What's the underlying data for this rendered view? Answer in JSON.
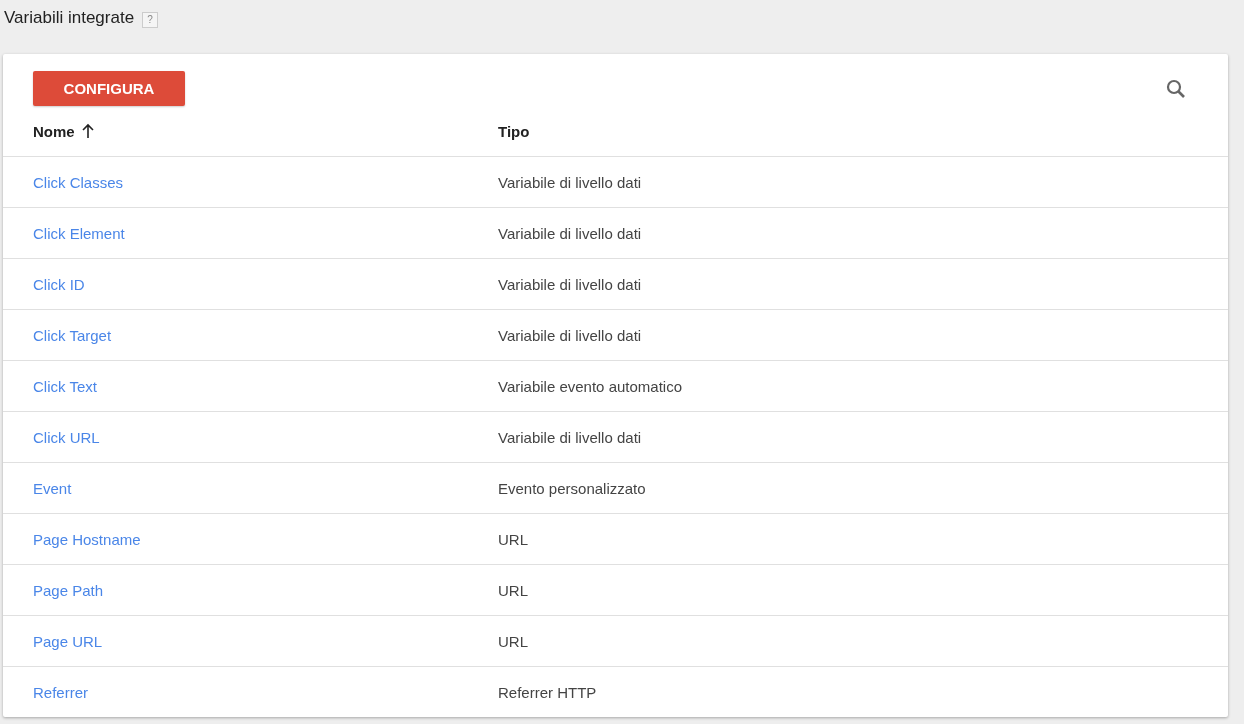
{
  "page": {
    "title": "Variabili integrate",
    "help": "?"
  },
  "toolbar": {
    "button": "CONFIGURA"
  },
  "table": {
    "columns": [
      {
        "label": "Nome",
        "sorted": true
      },
      {
        "label": "Tipo",
        "sorted": false
      }
    ],
    "rows": [
      {
        "name": "Click Classes",
        "type": "Variabile di livello dati"
      },
      {
        "name": "Click Element",
        "type": "Variabile di livello dati"
      },
      {
        "name": "Click ID",
        "type": "Variabile di livello dati"
      },
      {
        "name": "Click Target",
        "type": "Variabile di livello dati"
      },
      {
        "name": "Click Text",
        "type": "Variabile evento automatico"
      },
      {
        "name": "Click URL",
        "type": "Variabile di livello dati"
      },
      {
        "name": "Event",
        "type": "Evento personalizzato"
      },
      {
        "name": "Page Hostname",
        "type": "URL"
      },
      {
        "name": "Page Path",
        "type": "URL"
      },
      {
        "name": "Page URL",
        "type": "URL"
      },
      {
        "name": "Referrer",
        "type": "Referrer HTTP"
      }
    ]
  }
}
